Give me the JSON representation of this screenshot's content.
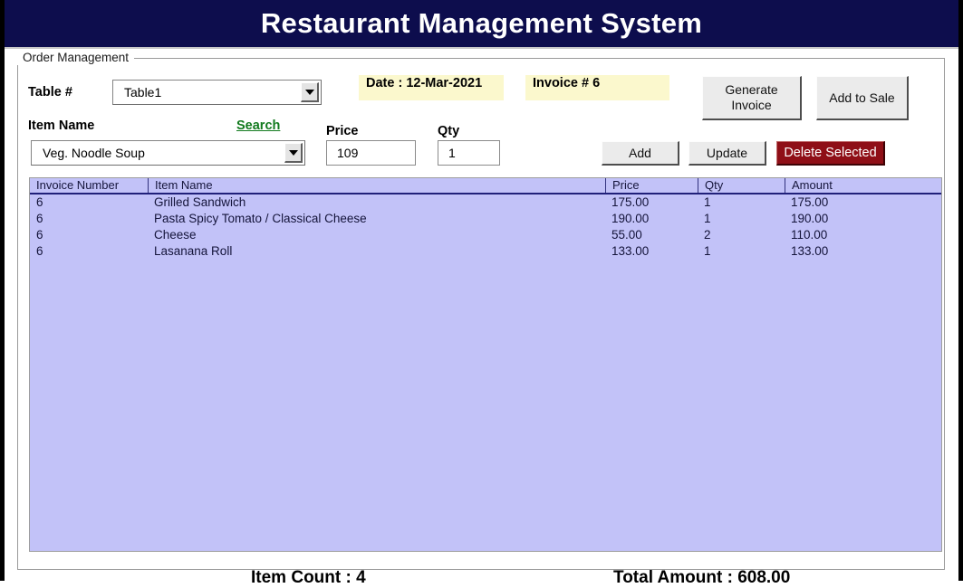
{
  "window": {
    "title": "Restaurant Management System"
  },
  "group": {
    "legend": "Order Management"
  },
  "form": {
    "table_label": "Table #",
    "table_value": "Table1",
    "item_name_label": "Item Name",
    "item_name_value": "Veg. Noodle Soup",
    "search_link": "Search",
    "price_label": "Price",
    "price_value": "109",
    "qty_label": "Qty",
    "qty_value": "1",
    "date_field": "Date : 12-Mar-2021",
    "invoice_field": "Invoice # 6"
  },
  "buttons": {
    "generate_invoice": "Generate\nInvoice",
    "generate_invoice_line1": "Generate",
    "generate_invoice_line2": "Invoice",
    "add_to_sale": "Add to Sale",
    "add": "Add",
    "update": "Update",
    "delete_selected": "Delete Selected"
  },
  "grid": {
    "columns": [
      "Invoice Number",
      "Item Name",
      "Price",
      "Qty",
      "Amount"
    ],
    "rows": [
      {
        "invoice_number": "6",
        "item_name": "Grilled Sandwich",
        "price": "175.00",
        "qty": "1",
        "amount": "175.00"
      },
      {
        "invoice_number": "6",
        "item_name": "Pasta Spicy Tomato / Classical Cheese",
        "price": "190.00",
        "qty": "1",
        "amount": "190.00"
      },
      {
        "invoice_number": "6",
        "item_name": "Cheese",
        "price": "55.00",
        "qty": "2",
        "amount": "110.00"
      },
      {
        "invoice_number": "6",
        "item_name": "Lasanana Roll",
        "price": "133.00",
        "qty": "1",
        "amount": "133.00"
      }
    ]
  },
  "footer": {
    "item_count": "Item Count : 4",
    "total_amount": "Total Amount : 608.00"
  },
  "colors": {
    "title_bar": "#0d0d4d",
    "grid_selection": "#c2c2f8",
    "yellow_field": "#fbf8cd",
    "danger_button": "#8f0f17",
    "link_green": "#127a1e"
  },
  "icons": {
    "dropdown": "chevron-down-icon"
  }
}
